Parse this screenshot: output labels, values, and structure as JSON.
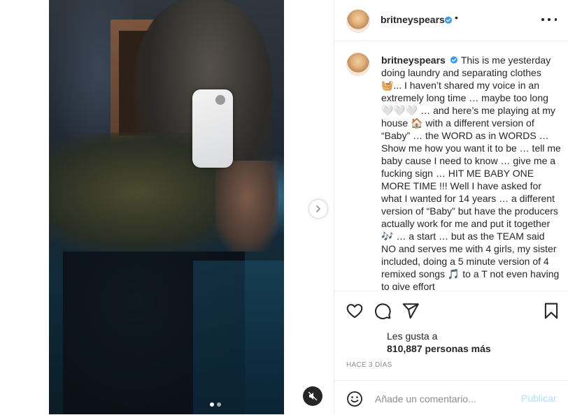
{
  "post": {
    "username": "britneyspears",
    "separator": "•",
    "caption": "This is me yesterday doing laundry and separating clothes 🧺... I haven’t shared my voice in an extremely long time … maybe too long 🤍🤍🤍 … and here’s me playing at my house 🏠 with a different version of “Baby” … the WORD as in WORDS … Show me how you want it to be … tell me baby cause I need to know … give me a fucking sign … HIT ME BABY ONE MORE TIME !!! Well I have asked for what I wanted for 14 years … a different version of “Baby” but have the producers actually work for me and put it together 🎶 … a start … but as the TEAM said NO and serves me with 4 girls, my sister included, doing a 5 minute version of 4 remixed songs 🎵 to a T not even having to give effort",
    "likes_prefix": "Les gusta a",
    "likes_count": "810,887 personas más",
    "time_ago": "HACE 3 DÍAS"
  },
  "comment": {
    "placeholder": "Añade un comentario...",
    "submit_label": "Publicar"
  },
  "carousel": {
    "total_slides": 2,
    "active_slide": 1
  },
  "colors": {
    "verified_badge": "#3897f0",
    "publish_disabled": "#b2dffc",
    "muted_text": "#8e8e8e"
  },
  "icons": [
    "verified-icon",
    "more-icon",
    "heart-icon",
    "comment-icon",
    "share-icon",
    "bookmark-icon",
    "emoji-icon",
    "chevron-right-icon",
    "mute-icon"
  ]
}
